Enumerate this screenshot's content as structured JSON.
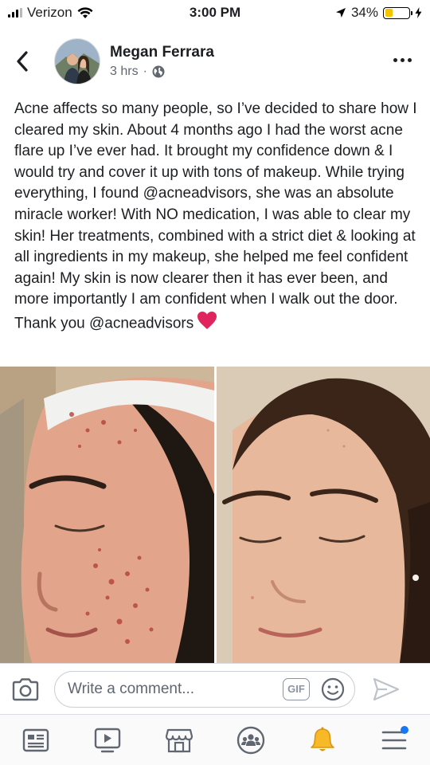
{
  "status_bar": {
    "carrier": "Verizon",
    "time": "3:00 PM",
    "battery": "34%",
    "battery_level": 0.34
  },
  "post": {
    "author": "Megan Ferrara",
    "time_ago": "3 hrs",
    "separator": "·",
    "text": "Acne affects so many people, so I’ve decided to share how I cleared my skin. About 4 months ago I had the worst acne flare up I’ve ever had. It brought my confidence down & I would try and cover it up with tons of makeup. While trying everything, I found @acneadvisors, she was an absolute miracle worker! With NO medication, I was able to clear my skin! Her treatments, combined with a strict diet & looking at all ingredients in my makeup, she helped me feel confident again! My skin is now clearer then it has ever been, and more importantly I am confident when I walk out the door. Thank you @acneadvisors"
  },
  "comment_bar": {
    "placeholder": "Write a comment...",
    "gif_label": "GIF"
  },
  "bottom_nav": {
    "items": [
      "news-feed",
      "watch",
      "marketplace",
      "groups",
      "notifications",
      "menu"
    ]
  },
  "colors": {
    "accent": "#1877f2",
    "heart": "#e0245e",
    "battery": "#f5c400"
  }
}
